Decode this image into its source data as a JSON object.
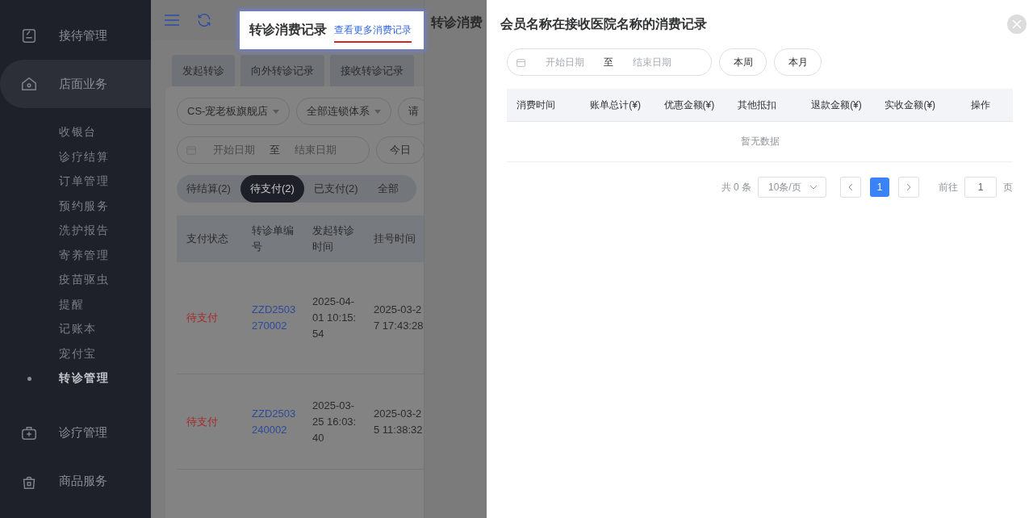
{
  "sidebar": {
    "groups": [
      {
        "label": "接待管理",
        "selected": false
      },
      {
        "label": "店面业务",
        "selected": true,
        "children": [
          {
            "label": "收银台",
            "selected": false
          },
          {
            "label": "诊疗结算",
            "selected": false
          },
          {
            "label": "订单管理",
            "selected": false
          },
          {
            "label": "预约服务",
            "selected": false
          },
          {
            "label": "洗护报告",
            "selected": false
          },
          {
            "label": "寄养管理",
            "selected": false
          },
          {
            "label": "疫苗驱虫",
            "selected": false
          },
          {
            "label": "提醒",
            "selected": false
          },
          {
            "label": "记账本",
            "selected": false
          },
          {
            "label": "宠付宝",
            "selected": false
          },
          {
            "label": "转诊管理",
            "selected": true
          }
        ]
      },
      {
        "label": "诊疗管理",
        "selected": false
      },
      {
        "label": "商品服务",
        "selected": false
      }
    ]
  },
  "highlight": {
    "title": "转诊消费记录",
    "link": "查看更多消费记录"
  },
  "toolbar_tabs": [
    "发起转诊",
    "向外转诊记录",
    "接收转诊记录"
  ],
  "filters": {
    "selects": [
      "CS-宠老板旗舰店",
      "全部连锁体系"
    ],
    "cut_field": "请",
    "date_range": {
      "start_placeholder": "开始日期",
      "separator": "至",
      "end_placeholder": "结束日期"
    },
    "today_button": "今日"
  },
  "status_tabs": [
    {
      "label": "待结算(2)",
      "selected": false
    },
    {
      "label": "待支付(2)",
      "selected": true
    },
    {
      "label": "已支付(2)",
      "selected": false
    },
    {
      "label": "全部",
      "selected": false
    }
  ],
  "table": {
    "columns": [
      "支付状态",
      "转诊单编号",
      "发起转诊时间",
      "挂号时间"
    ],
    "rows": [
      {
        "status": "待支付",
        "number": "ZZD2503270002",
        "created": "2025-04-01 10:15:54",
        "registered": "2025-03-27 17:43:28"
      },
      {
        "status": "待支付",
        "number": "ZZD2503240002",
        "created": "2025-03-25 16:03:40",
        "registered": "2025-03-25 11:38:32"
      }
    ]
  },
  "middle_panel": {
    "title": "转诊消费"
  },
  "drawer": {
    "title": "会员名称在接收医院名称的消费记录",
    "date_range": {
      "start_placeholder": "开始日期",
      "separator": "至",
      "end_placeholder": "结束日期"
    },
    "quick_buttons": [
      "本周",
      "本月"
    ],
    "columns": [
      "消费时间",
      "账单总计(¥)",
      "优惠金额(¥)",
      "其他抵扣",
      "退款金额(¥)",
      "实收金额(¥)",
      "操作"
    ],
    "empty_text": "暂无数据",
    "pagination": {
      "total": "共 0 条",
      "page_size": "10条/页",
      "pages": [
        {
          "label": "1",
          "selected": true
        }
      ],
      "goto_label": "前往",
      "goto_value": "1",
      "goto_suffix": "页"
    }
  }
}
